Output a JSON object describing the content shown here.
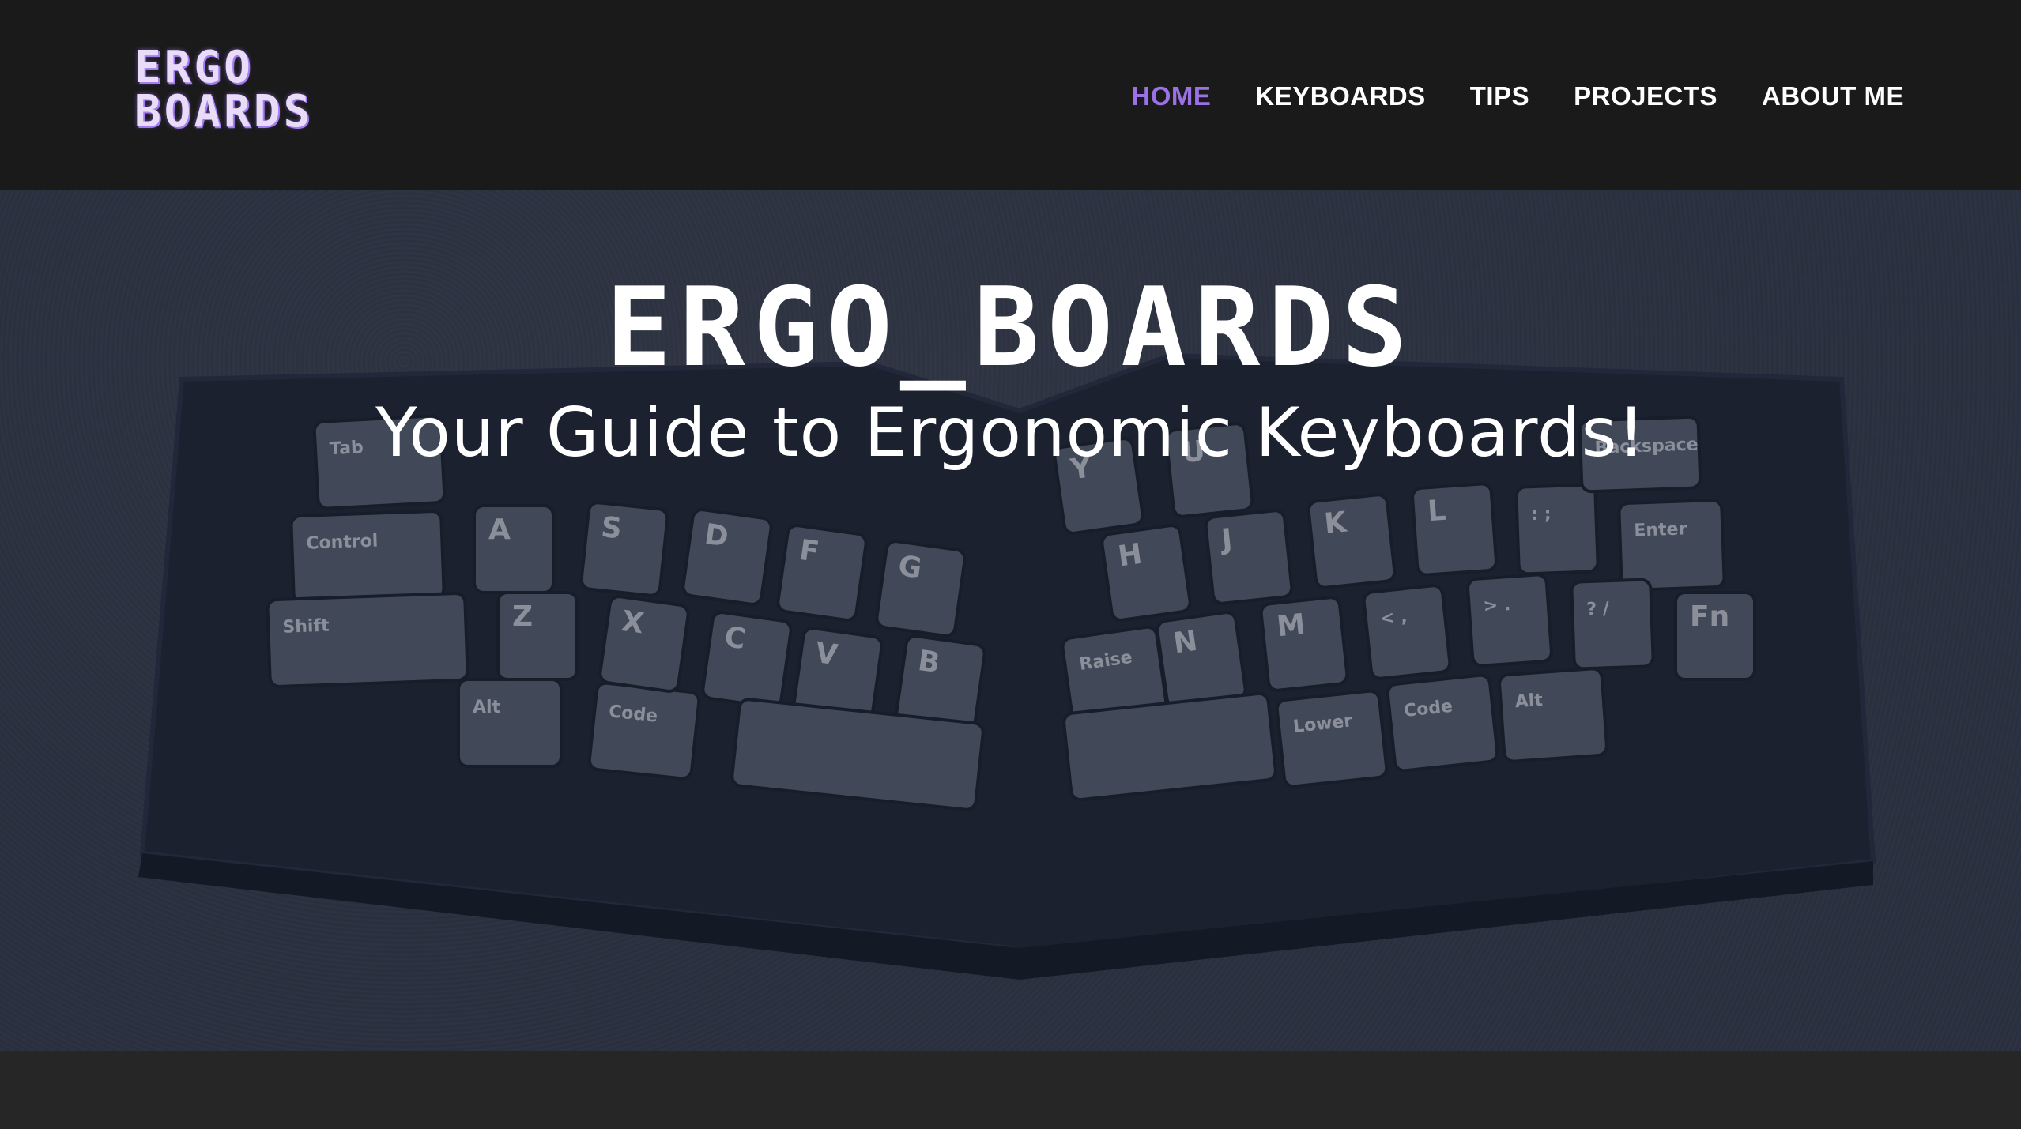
{
  "site": {
    "logo_line1": "ERGO",
    "logo_line2": "BOARDS"
  },
  "nav": {
    "items": [
      {
        "label": "HOME",
        "active": true
      },
      {
        "label": "KEYBOARDS",
        "active": false
      },
      {
        "label": "TIPS",
        "active": false
      },
      {
        "label": "PROJECTS",
        "active": false
      },
      {
        "label": "ABOUT ME",
        "active": false
      }
    ]
  },
  "hero": {
    "title": "ERGO_BOARDS",
    "subtitle": "Your Guide to Ergonomic Keyboards!",
    "image_keys": {
      "tab": "Tab",
      "control": "Control",
      "shift": "Shift",
      "alt_left": "Alt",
      "code_left": "Code",
      "a": "A",
      "s": "S",
      "d": "D",
      "f": "F",
      "g": "G",
      "z": "Z",
      "x": "X",
      "c": "C",
      "v": "V",
      "b": "B",
      "y": "Y",
      "u": "U",
      "h": "H",
      "j": "J",
      "k": "K",
      "l": "L",
      "semicolon": ":\n;",
      "enter": "Enter",
      "backspace": "Backspace",
      "raise": "Raise",
      "n": "N",
      "m": "M",
      "comma": "<\n,",
      "period": ">\n.",
      "slash": "?\n/",
      "fn": "Fn",
      "lower": "Lower",
      "code_right": "Code",
      "alt_right": "Alt"
    }
  },
  "colors": {
    "header_bg": "#1a1a1b",
    "accent": "#9b72e6",
    "page_bg": "#262626",
    "text": "#ffffff"
  }
}
